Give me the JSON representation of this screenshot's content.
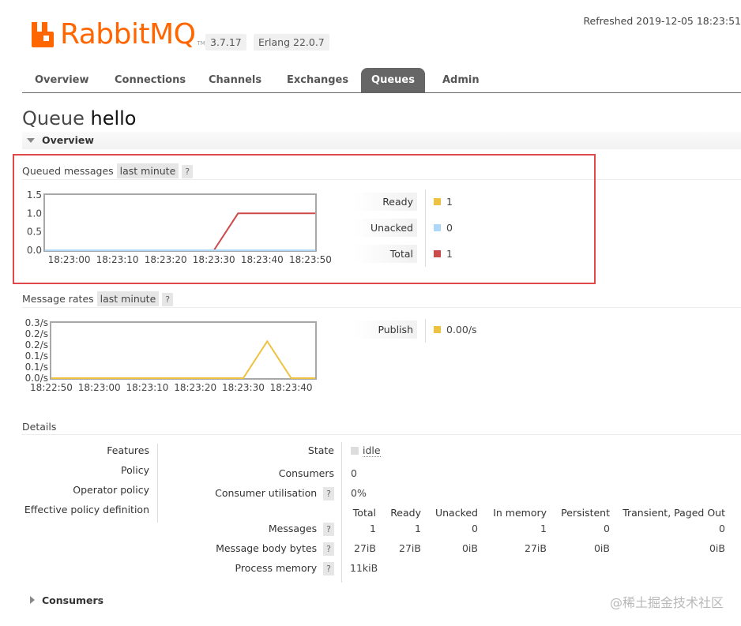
{
  "header": {
    "brand": "RabbitMQ",
    "trademark": "TM",
    "rabbitmq_version": "3.7.17",
    "erlang_version": "Erlang 22.0.7",
    "refreshed": "Refreshed 2019-12-05 18:23:51"
  },
  "nav": {
    "tabs": [
      "Overview",
      "Connections",
      "Channels",
      "Exchanges",
      "Queues",
      "Admin"
    ],
    "active": "Queues"
  },
  "page": {
    "title_prefix": "Queue",
    "queue_name": "hello"
  },
  "overview_section": {
    "label": "Overview"
  },
  "queued_messages": {
    "label": "Queued messages",
    "range": "last minute",
    "help": "?",
    "legend": [
      {
        "label": "Ready",
        "value": "1",
        "color": "#edc240"
      },
      {
        "label": "Unacked",
        "value": "0",
        "color": "#afd8f8"
      },
      {
        "label": "Total",
        "value": "1",
        "color": "#cb4b4b"
      }
    ]
  },
  "message_rates": {
    "label": "Message rates",
    "range": "last minute",
    "help": "?",
    "legend": [
      {
        "label": "Publish",
        "value": "0.00/s",
        "color": "#edc240"
      }
    ]
  },
  "chart_data": [
    {
      "type": "line",
      "ylim": [
        0,
        1.5
      ],
      "yticks": [
        "1.5",
        "1.0",
        "0.5",
        "0.0"
      ],
      "xticks": [
        "18:23:00",
        "18:23:10",
        "18:23:20",
        "18:23:30",
        "18:23:40",
        "18:23:50"
      ],
      "series": [
        {
          "name": "Total",
          "color": "#cb4b4b",
          "x": [
            "18:22:55",
            "18:23:30",
            "18:23:35",
            "18:23:51"
          ],
          "values": [
            0,
            0,
            1,
            1
          ]
        },
        {
          "name": "Unacked",
          "color": "#afd8f8",
          "x": [
            "18:22:55",
            "18:23:51"
          ],
          "values": [
            0,
            0
          ]
        }
      ]
    },
    {
      "type": "line",
      "ylim": [
        0,
        0.3
      ],
      "yticks": [
        "0.3/s",
        "0.2/s",
        "0.2/s",
        "0.1/s",
        "0.1/s",
        "0.0/s"
      ],
      "xticks": [
        "18:22:50",
        "18:23:00",
        "18:23:10",
        "18:23:20",
        "18:23:30",
        "18:23:40"
      ],
      "series": [
        {
          "name": "Publish",
          "color": "#edc240",
          "x": [
            "18:22:50",
            "18:23:30",
            "18:23:35",
            "18:23:40",
            "18:23:45"
          ],
          "values": [
            0,
            0,
            0.2,
            0,
            0
          ]
        }
      ]
    }
  ],
  "details": {
    "label": "Details",
    "left_labels": [
      "Features",
      "Policy",
      "Operator policy",
      "Effective policy definition"
    ],
    "state_label": "State",
    "state_value": "idle",
    "consumers_label": "Consumers",
    "consumers_value": "0",
    "consumer_util_label": "Consumer utilisation",
    "consumer_util_value": "0%",
    "help": "?",
    "columns": [
      "Total",
      "Ready",
      "Unacked",
      "In memory",
      "Persistent",
      "Transient, Paged Out"
    ],
    "rows": [
      {
        "label": "Messages",
        "values": [
          "1",
          "1",
          "0",
          "1",
          "0",
          "0"
        ]
      },
      {
        "label": "Message body bytes",
        "values": [
          "27iB",
          "27iB",
          "0iB",
          "27iB",
          "0iB",
          "0iB"
        ]
      }
    ],
    "process_memory_label": "Process memory",
    "process_memory_value": "11kiB"
  },
  "consumers_section": {
    "label": "Consumers"
  },
  "watermark": "@稀土掘金技术社区"
}
